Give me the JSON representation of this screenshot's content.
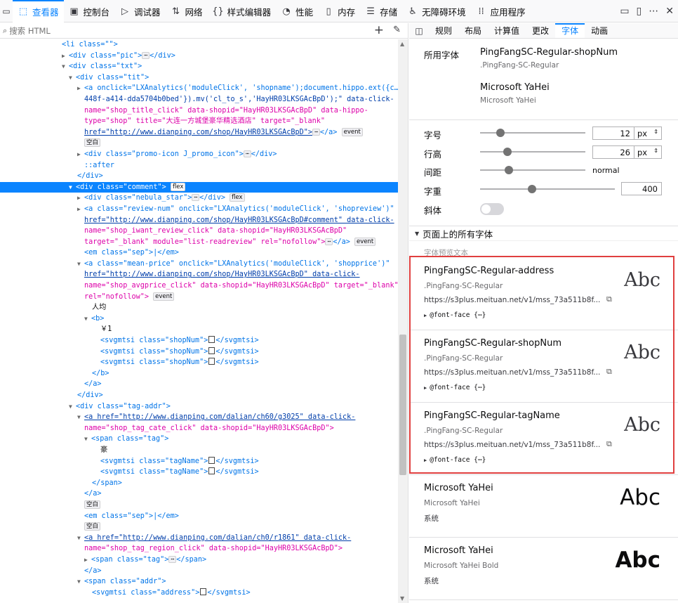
{
  "toolbar": {
    "tabs": [
      {
        "label": "查看器",
        "icon": "inspector-icon"
      },
      {
        "label": "控制台",
        "icon": "console-icon"
      },
      {
        "label": "调试器",
        "icon": "debugger-icon"
      },
      {
        "label": "网络",
        "icon": "network-icon"
      },
      {
        "label": "样式编辑器",
        "icon": "style-editor-icon"
      },
      {
        "label": "性能",
        "icon": "performance-icon"
      },
      {
        "label": "内存",
        "icon": "memory-icon"
      },
      {
        "label": "存储",
        "icon": "storage-icon"
      },
      {
        "label": "无障碍环境",
        "icon": "accessibility-icon"
      },
      {
        "label": "应用程序",
        "icon": "application-icon"
      }
    ]
  },
  "search": {
    "placeholder": "搜索 HTML"
  },
  "right_tabs": [
    "规则",
    "布局",
    "计算值",
    "更改",
    "字体",
    "动画"
  ],
  "used_fonts": {
    "label": "所用字体",
    "fonts": [
      {
        "name": "PingFangSC-Regular-shopNum",
        "sub": ".PingFang-SC-Regular"
      },
      {
        "name": "Microsoft YaHei",
        "sub": "Microsoft YaHei"
      }
    ]
  },
  "props": {
    "size_label": "字号",
    "size_value": "12",
    "size_unit": "px",
    "line_label": "行高",
    "line_value": "26",
    "line_unit": "px",
    "spacing_label": "间距",
    "spacing_value": "normal",
    "weight_label": "字重",
    "weight_value": "400",
    "italic_label": "斜体"
  },
  "all_fonts": {
    "header": "页面上的所有字体",
    "preview_label": "字体预览文本",
    "cards": [
      {
        "name": "PingFangSC-Regular-address",
        "sub": ".PingFang-SC-Regular",
        "url": "https://s3plus.meituan.net/v1/mss_73a511b8f...",
        "fontface": "@font-face {⋯}",
        "preview": "Abc"
      },
      {
        "name": "PingFangSC-Regular-shopNum",
        "sub": ".PingFang-SC-Regular",
        "url": "https://s3plus.meituan.net/v1/mss_73a511b8f...",
        "fontface": "@font-face {⋯}",
        "preview": "Abc"
      },
      {
        "name": "PingFangSC-Regular-tagName",
        "sub": ".PingFang-SC-Regular",
        "url": "https://s3plus.meituan.net/v1/mss_73a511b8f...",
        "fontface": "@font-face {⋯}",
        "preview": "Abc"
      },
      {
        "name": "Microsoft YaHei",
        "sub": "Microsoft YaHei",
        "url": "系统",
        "preview": "Abc"
      },
      {
        "name": "Microsoft YaHei",
        "sub": "Microsoft YaHei Bold",
        "url": "系统",
        "preview": "Abc"
      }
    ]
  },
  "code_lines": [
    "<li class=\"\">",
    "<div class=\"pic\">",
    "<div class=\"txt\">",
    "<div class=\"tit\">",
    "<a onclick=\"LXAnalytics('moduleClick', 'shopname');document.hippo.ext({c…-",
    "448f-a414-dda5704b0bed'}).mv('cl_to_s','HayHR03LKSGAcBpD');\" data-click-",
    "name=\"shop_title_click\" data-shopid=\"HayHR03LKSGAcBpD\" data-hippo-",
    "type=\"shop\" title=\"大连一方城堡豪华精选酒店\" target=\"_blank\"",
    "href=\"http://www.dianping.com/shop/HayHR03LKSGAcBpD\">",
    "空白",
    "<div class=\"promo-icon J_promo_icon\">",
    "::after",
    "</div>",
    "<div class=\"comment\">",
    "<div class=\"nebula_star\">",
    "<a class=\"review-num\" onclick=\"LXAnalytics('moduleClick', 'shopreview')\"",
    "href=\"http://www.dianping.com/shop/HayHR03LKSGAcBpD#comment\" data-click-",
    "name=\"shop_iwant_review_click\" data-shopid=\"HayHR03LKSGAcBpD\"",
    "target=\"_blank\" module=\"list-readreview\" rel=\"nofollow\">",
    "<em class=\"sep\">|</em>",
    "<a class=\"mean-price\" onclick=\"LXAnalytics('moduleClick', 'shopprice')\"",
    "href=\"http://www.dianping.com/shop/HayHR03LKSGAcBpD\" data-click-",
    "name=\"shop_avgprice_click\" data-shopid=\"HayHR03LKSGAcBpD\" target=\"_blank\"",
    "rel=\"nofollow\">",
    "人均",
    "<b>",
    "￥1",
    "<svgmtsi class=\"shopNum\">",
    "<svgmtsi class=\"shopNum\">",
    "<svgmtsi class=\"shopNum\">",
    "</b>",
    "</a>",
    "</div>",
    "<div class=\"tag-addr\">",
    "<a href=\"http://www.dianping.com/dalian/ch60/g3025\" data-click-",
    "name=\"shop_tag_cate_click\" data-shopid=\"HayHR03LKSGAcBpD\">",
    "<span class=\"tag\">",
    "豪",
    "<svgmtsi class=\"tagName\">",
    "<svgmtsi class=\"tagName\">",
    "</span>",
    "</a>",
    "空白",
    "<em class=\"sep\">|</em>",
    "空白",
    "<a href=\"http://www.dianping.com/dalian/ch0/r1861\" data-click-",
    "name=\"shop_tag_region_click\" data-shopid=\"HayHR03LKSGAcBpD\">",
    "<span class=\"tag\">",
    "</a>",
    "<span class=\"addr\">",
    "<svgmtsi class=\"address\">"
  ],
  "badges": {
    "event": "event",
    "flex": "flex",
    "blank": "空白",
    "after": "::after"
  },
  "colors": {
    "accent": "#0a84ff",
    "highlight_border": "#e03f3f",
    "tag": "#0074e8",
    "attr_name": "#dd00a9",
    "attr_value": "#003eaa"
  }
}
